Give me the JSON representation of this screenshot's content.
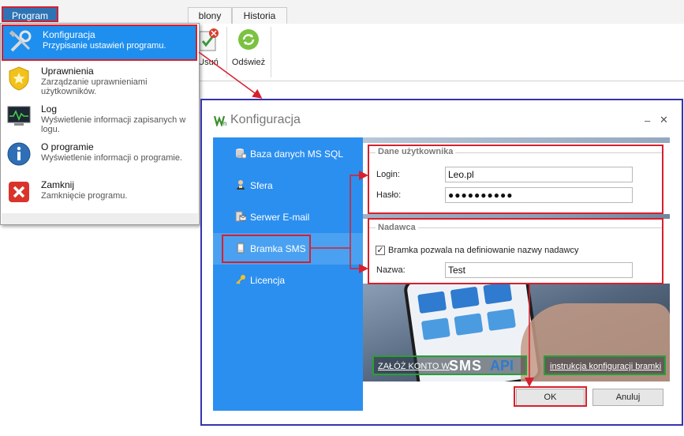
{
  "app": {
    "program_button": "Program",
    "tabs": [
      "blony",
      "Historia"
    ],
    "toolbar": {
      "delete_label": "Usuń",
      "refresh_label": "Odśwież"
    }
  },
  "program_menu": {
    "items": [
      {
        "title": "Konfiguracja",
        "desc": "Przypisanie ustawień programu.",
        "icon": "tools-icon"
      },
      {
        "title": "Uprawnienia",
        "desc": "Zarządzanie uprawnieniami użytkowników.",
        "icon": "badge-icon"
      },
      {
        "title": "Log",
        "desc": "Wyświetlenie informacji zapisanych w logu.",
        "icon": "log-monitor-icon"
      },
      {
        "title": "O programie",
        "desc": "Wyświetlenie informacji o programie.",
        "icon": "info-icon"
      },
      {
        "title": "Zamknij",
        "desc": "Zamknięcie programu.",
        "icon": "close-red-icon"
      }
    ]
  },
  "dialog": {
    "title": "Konfiguracja",
    "controls": {
      "minimize": "–",
      "close": "✕"
    },
    "nav": [
      {
        "label": "Baza danych MS SQL",
        "icon": "database-icon"
      },
      {
        "label": "Sfera",
        "icon": "person-icon"
      },
      {
        "label": "Serwer E-mail",
        "icon": "mail-server-icon"
      },
      {
        "label": "Bramka SMS",
        "icon": "phone-icon"
      },
      {
        "label": "Licencja",
        "icon": "key-icon"
      }
    ],
    "user_group": {
      "legend": "Dane użytkownika",
      "login_label": "Login:",
      "login_value": "Leo.pl",
      "password_label": "Hasło:",
      "password_value": "●●●●●●●●●●"
    },
    "sender_group": {
      "legend": "Nadawca",
      "checkbox_label": "Bramka pozwala na definiowanie nazwy nadawcy",
      "checkbox_checked": true,
      "checkbox_mark": "✓",
      "name_label": "Nazwa:",
      "name_value": "Test"
    },
    "register_link": "ZAŁÓŻ KONTO W",
    "brand_sms": "SMS",
    "brand_api": "API",
    "instructions_link": "instrukcja konfiguracji bramki",
    "ok_label": "OK",
    "cancel_label": "Anuluj"
  },
  "colors": {
    "accent_blue": "#2b8ff0",
    "highlight_red": "#d6202e",
    "link_green": "#28a035",
    "dialog_border": "#3434ae"
  }
}
